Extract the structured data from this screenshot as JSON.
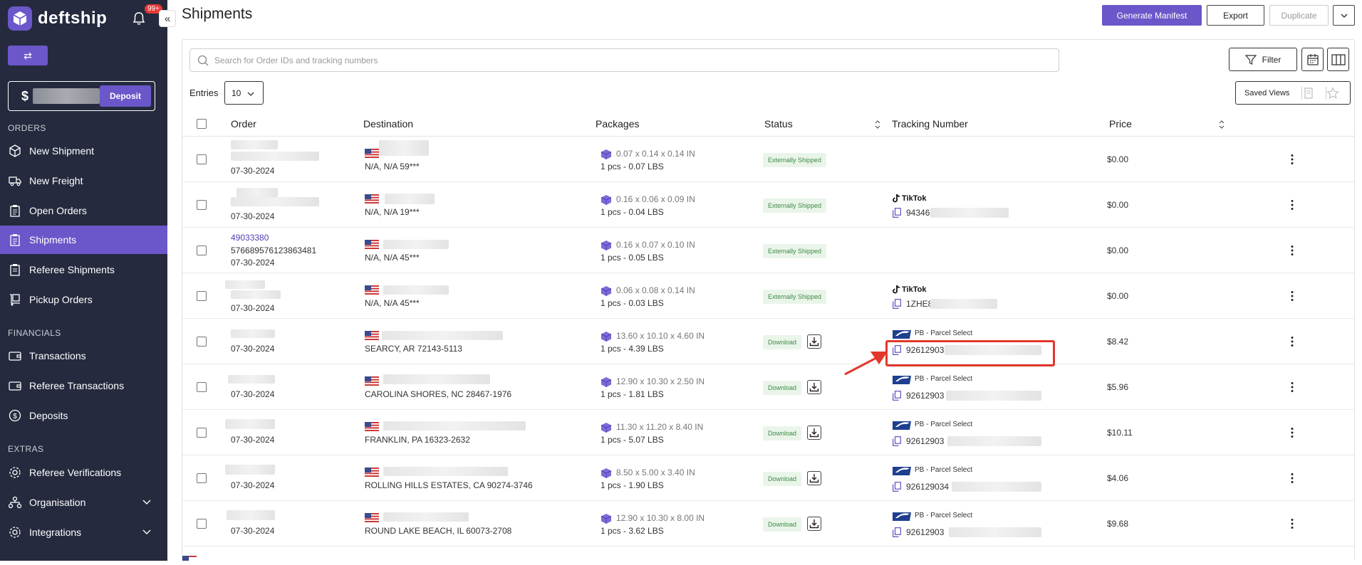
{
  "brand": {
    "name": "deftship"
  },
  "notifications": {
    "count": "99+"
  },
  "sidebar": {
    "balance": {
      "currency": "$",
      "deposit_label": "Deposit"
    },
    "sections": {
      "orders": "ORDERS",
      "financials": "FINANCIALS",
      "extras": "EXTRAS"
    },
    "items": {
      "new_shipment": "New Shipment",
      "new_freight": "New Freight",
      "open_orders": "Open Orders",
      "shipments": "Shipments",
      "referee_shipments": "Referee Shipments",
      "pickup_orders": "Pickup Orders",
      "transactions": "Transactions",
      "referee_transactions": "Referee Transactions",
      "deposits": "Deposits",
      "referee_verifications": "Referee Verifications",
      "organisation": "Organisation",
      "integrations": "Integrations"
    }
  },
  "header": {
    "title": "Shipments",
    "generate_manifest": "Generate Manifest",
    "export": "Export",
    "duplicate": "Duplicate"
  },
  "toolbar": {
    "search_placeholder": "Search for Order IDs and tracking numbers",
    "filter": "Filter",
    "entries_label": "Entries",
    "entries_value": "10",
    "saved_views": "Saved Views"
  },
  "table": {
    "headers": {
      "order": "Order",
      "destination": "Destination",
      "packages": "Packages",
      "status": "Status",
      "tracking": "Tracking Number",
      "price": "Price"
    },
    "rows": [
      {
        "order_id": "",
        "order_sub": "",
        "date": "07-30-2024",
        "destination": "N/A, N/A 59***",
        "dims": "0.07 x 0.14 x 0.14 IN",
        "pcs": "1 pcs - 0.07 LBS",
        "status": "Externally Shipped",
        "carrier": "",
        "tracking": "",
        "price": "$0.00"
      },
      {
        "order_id": "",
        "order_sub": "",
        "date": "07-30-2024",
        "destination": "N/A, N/A 19***",
        "dims": "0.16 x 0.06 x 0.09 IN",
        "pcs": "1 pcs - 0.04 LBS",
        "status": "Externally Shipped",
        "carrier": "TikTok",
        "tracking": "94346",
        "price": "$0.00"
      },
      {
        "order_id": "49033380",
        "order_sub": "576689576123863481",
        "date": "07-30-2024",
        "destination": "N/A, N/A 45***",
        "dims": "0.16 x 0.07 x 0.10 IN",
        "pcs": "1 pcs - 0.05 LBS",
        "status": "Externally Shipped",
        "carrier": "",
        "tracking": "",
        "price": "$0.00"
      },
      {
        "order_id": "",
        "order_sub": "",
        "date": "07-30-2024",
        "destination": "N/A, N/A 45***",
        "dims": "0.06 x 0.08 x 0.14 IN",
        "pcs": "1 pcs - 0.03 LBS",
        "status": "Externally Shipped",
        "carrier": "TikTok",
        "tracking": "1ZHE8",
        "price": "$0.00"
      },
      {
        "order_id": "",
        "order_sub": "",
        "date": "07-30-2024",
        "destination": "SEARCY, AR 72143-5113",
        "dims": "13.60 x 10.10 x 4.60 IN",
        "pcs": "1 pcs - 4.39 LBS",
        "status": "Download",
        "carrier": "PB - Parcel Select",
        "tracking": "92612903",
        "price": "$8.42"
      },
      {
        "order_id": "",
        "order_sub": "",
        "date": "07-30-2024",
        "destination": "CAROLINA SHORES, NC 28467-1976",
        "dims": "12.90 x 10.30 x 2.50 IN",
        "pcs": "1 pcs - 1.81 LBS",
        "status": "Download",
        "carrier": "PB - Parcel Select",
        "tracking": "92612903",
        "price": "$5.96"
      },
      {
        "order_id": "",
        "order_sub": "",
        "date": "07-30-2024",
        "destination": "FRANKLIN, PA 16323-2632",
        "dims": "11.30 x 11.20 x 8.40 IN",
        "pcs": "1 pcs - 5.07 LBS",
        "status": "Download",
        "carrier": "PB - Parcel Select",
        "tracking": "92612903",
        "price": "$10.11"
      },
      {
        "order_id": "",
        "order_sub": "",
        "date": "07-30-2024",
        "destination": "ROLLING HILLS ESTATES, CA 90274-3746",
        "dims": "8.50 x 5.00 x 3.40 IN",
        "pcs": "1 pcs - 1.90 LBS",
        "status": "Download",
        "carrier": "PB - Parcel Select",
        "tracking": "926129034",
        "price": "$4.06"
      },
      {
        "order_id": "",
        "order_sub": "",
        "date": "07-30-2024",
        "destination": "ROUND LAKE BEACH, IL 60073-2708",
        "dims": "12.90 x 10.30 x 8.00 IN",
        "pcs": "1 pcs - 3.62 LBS",
        "status": "Download",
        "carrier": "PB - Parcel Select",
        "tracking": "92612903",
        "price": "$9.68"
      }
    ]
  },
  "colors": {
    "accent": "#6b57c9",
    "sidebar_bg": "#252a3e",
    "annotation": "#e2372b"
  }
}
